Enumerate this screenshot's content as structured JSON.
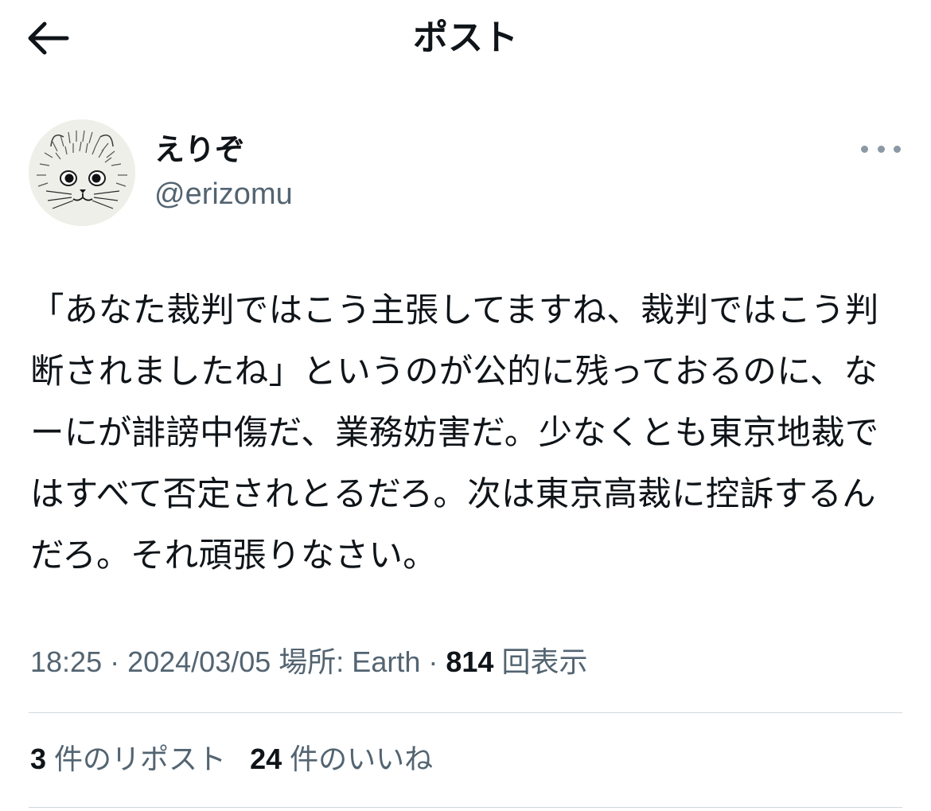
{
  "header": {
    "title": "ポスト",
    "back_icon": "arrow-left-icon"
  },
  "author": {
    "display_name": "えりぞ",
    "handle": "@erizomu",
    "avatar_icon": "cat-sketch-avatar",
    "more_icon": "more-dots-icon"
  },
  "tweet": {
    "text": "「あなた裁判ではこう主張してますね、裁判ではこう判断されましたね」というのが公的に残っておるのに、なーにが誹謗中傷だ、業務妨害だ。少なくとも東京地裁ではすべて否定されとるだろ。次は東京高裁に控訴するんだろ。それ頑張りなさい。"
  },
  "meta": {
    "time": "18:25",
    "separator1": " · ",
    "date": "2024/03/05",
    "location": "場所: Earth",
    "separator2": " · ",
    "views_count": "814",
    "views_label": "回表示"
  },
  "stats": {
    "reposts_count": "3",
    "reposts_label": "件のリポスト",
    "likes_count": "24",
    "likes_label": "件のいいね"
  },
  "colors": {
    "text_primary": "#0f1419",
    "text_secondary": "#536471",
    "divider": "#cfd9de"
  }
}
